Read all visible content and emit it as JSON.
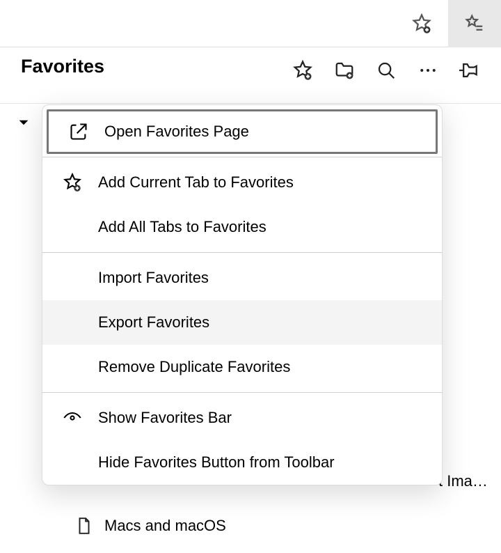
{
  "header": {
    "title": "Favorites"
  },
  "menu": {
    "open_page": "Open Favorites Page",
    "add_current": "Add Current Tab to Favorites",
    "add_all": "Add All Tabs to Favorites",
    "import": "Import Favorites",
    "export": "Export Favorites",
    "dedupe": "Remove Duplicate Favorites",
    "show_bar": "Show Favorites Bar",
    "hide_button": "Hide Favorites Button from Toolbar"
  },
  "background": {
    "ima_truncated": "t Ima…",
    "macs": "Macs and macOS"
  }
}
